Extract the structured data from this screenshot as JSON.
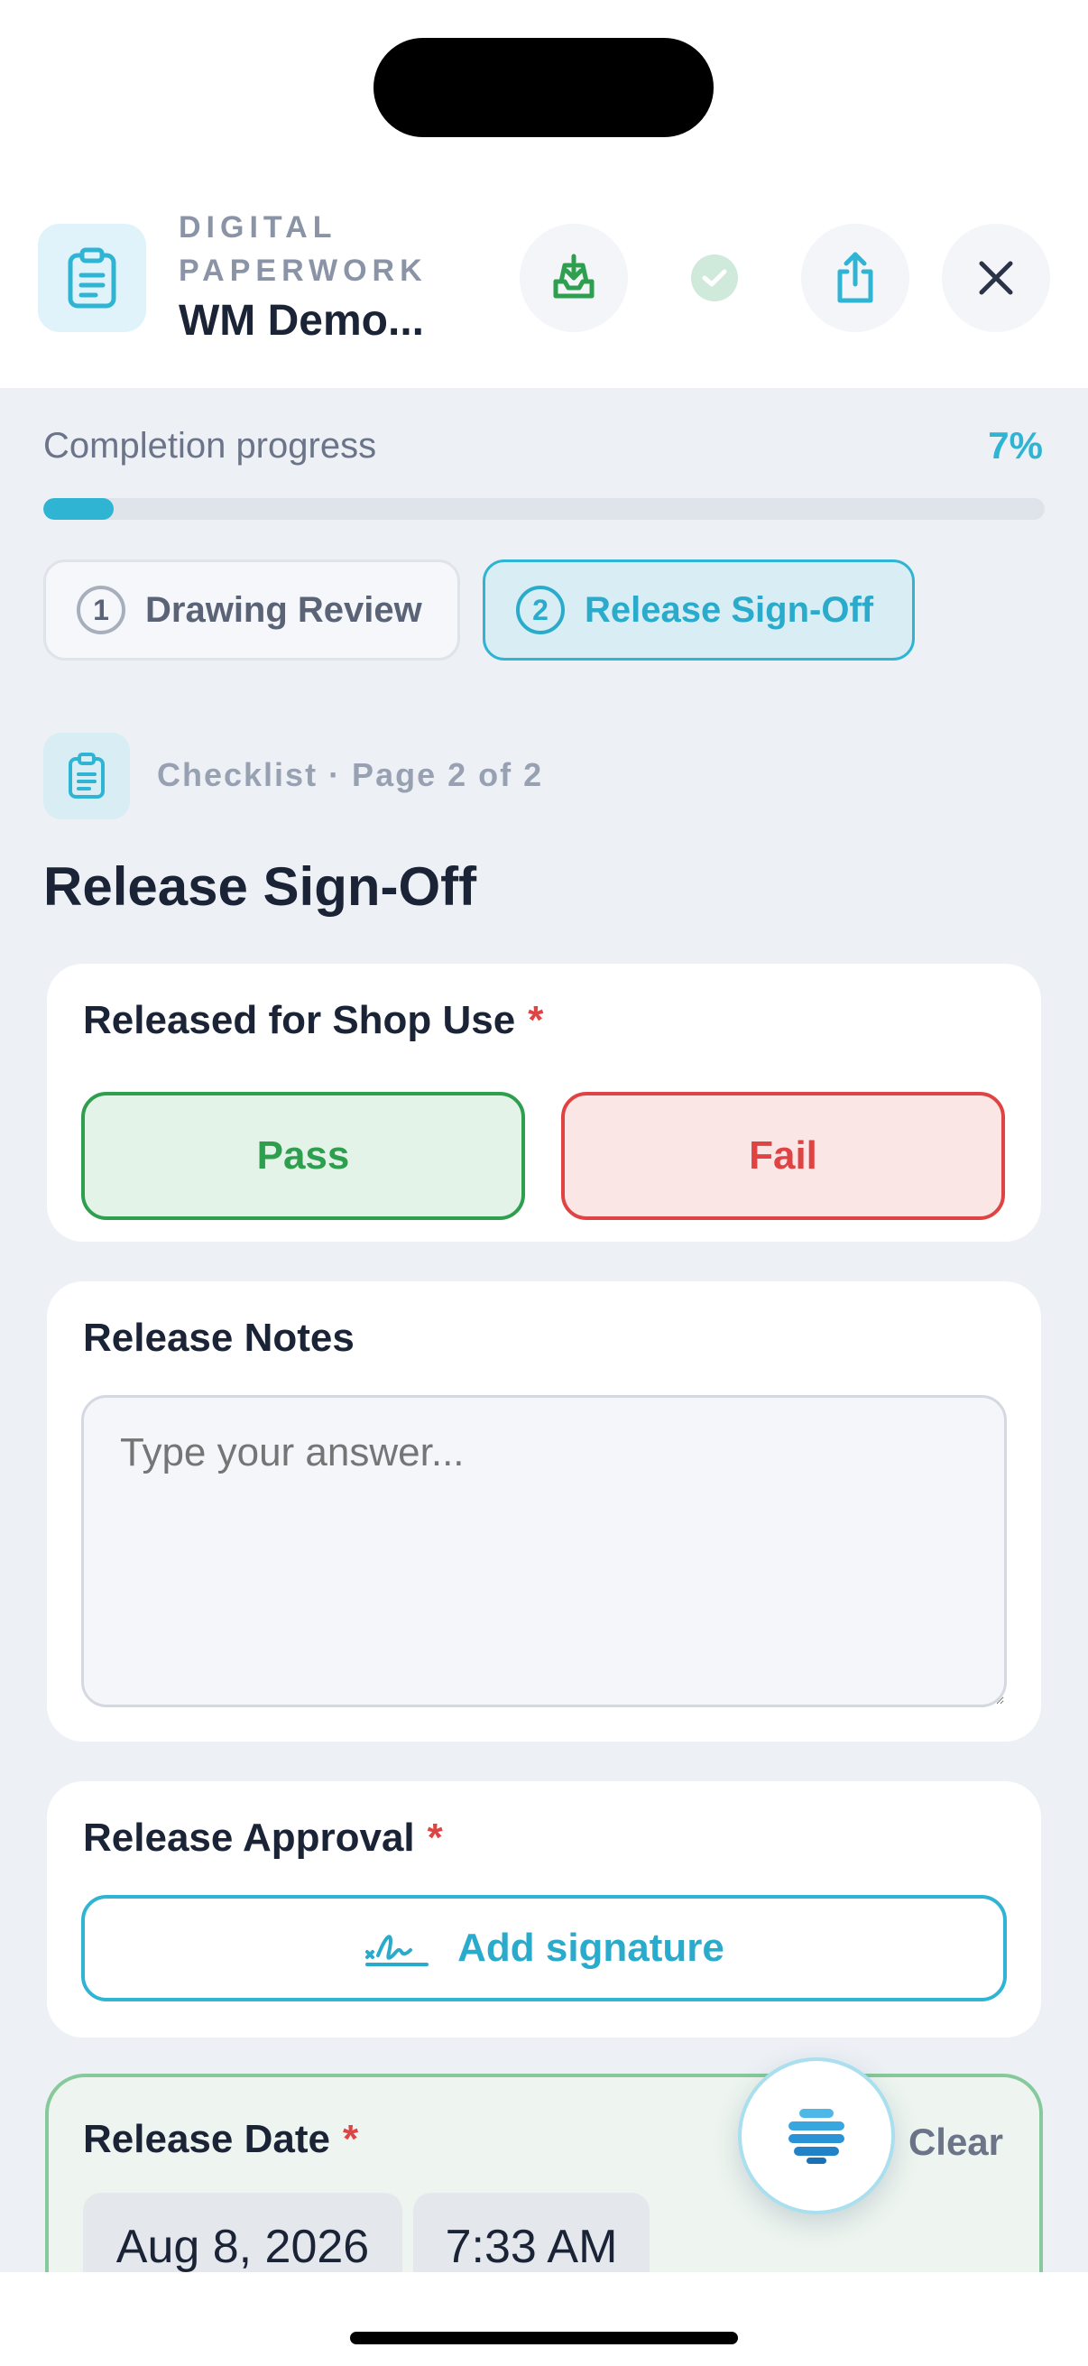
{
  "header": {
    "eyebrow": "Digital Paperwork",
    "title": "WM Demo...",
    "icons": {
      "app": "clipboard-icon",
      "save": "inbox-download-icon",
      "status": "check-circle-icon",
      "share": "share-icon",
      "close": "close-icon"
    }
  },
  "progress": {
    "label": "Completion progress",
    "percent_text": "7%",
    "value": 0.07
  },
  "steps": [
    {
      "number": "1",
      "label": "Drawing Review",
      "active": false
    },
    {
      "number": "2",
      "label": "Release Sign-Off",
      "active": true
    }
  ],
  "page": {
    "crumb": "Checklist · Page 2 of 2",
    "title": "Release Sign-Off"
  },
  "questions": {
    "released": {
      "label": "Released for Shop Use",
      "required_mark": "*",
      "pass_label": "Pass",
      "fail_label": "Fail"
    },
    "notes": {
      "label": "Release Notes",
      "placeholder": "Type your answer..."
    },
    "approval": {
      "label": "Release Approval",
      "required_mark": "*",
      "button_label": "Add signature"
    },
    "date": {
      "label": "Release Date",
      "required_mark": "*",
      "clear_label": "Clear",
      "date_value": "Aug 8, 2026",
      "time_value": "7:33 AM"
    }
  },
  "colors": {
    "accent": "#2fb4d4",
    "pass": "#2e9e4f",
    "fail": "#e04343"
  }
}
